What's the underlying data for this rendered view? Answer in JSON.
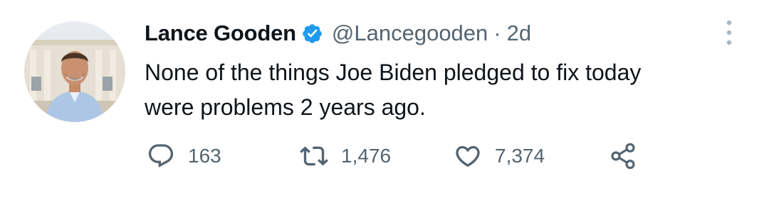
{
  "tweet": {
    "author": {
      "name": "Lance Gooden",
      "handle": "@Lancegooden",
      "verified": true,
      "avatar_icon": "profile-photo"
    },
    "separator": "·",
    "timestamp": "2d",
    "text_lines": [
      "None of the things Joe Biden pledged to fix today",
      "were problems 2 years ago."
    ],
    "actions": {
      "reply_count": "163",
      "retweet_count": "1,476",
      "like_count": "7,374",
      "share_icon": "share-icon"
    }
  },
  "colors": {
    "text": "#0f1419",
    "secondary": "#536471",
    "verified": "#1d9bf0"
  }
}
